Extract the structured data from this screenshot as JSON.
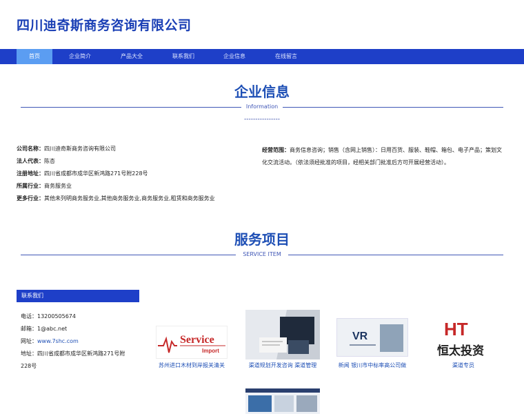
{
  "site": {
    "title": "四川迪奇斯商务咨询有限公司"
  },
  "nav": {
    "items": [
      {
        "label": "首页"
      },
      {
        "label": "企业简介"
      },
      {
        "label": "产品大全"
      },
      {
        "label": "联系我们"
      },
      {
        "label": "企业信息"
      },
      {
        "label": "在线留言"
      }
    ]
  },
  "company_info": {
    "title": "企业信息",
    "subtitle": "Information",
    "dashes": "----------------",
    "name_label": "公司名称：",
    "name": "四川迪奇斯商务咨询有限公司",
    "legal_label": "法人代表：",
    "legal": "陈杏",
    "address_label": "注册地址：",
    "address": "四川省成都市成华区新鸿路271号附228号",
    "industry_label": "所属行业：",
    "industry": "商务服务业",
    "more_label": "更多行业：",
    "more": "其他未列明商务服务业,其他商务服务业,商务服务业,租赁和商务服务业",
    "scope_label": "经营范围：",
    "scope": "商务信息咨询；销售（含网上销售）：日用百货、服装、鞋帽、箱包、电子产品；策划文化交流活动。（依法须经批准的项目，经相关部门批准后方可开展经营活动）。"
  },
  "services": {
    "title": "服务项目",
    "subtitle": "SERVICE ITEM"
  },
  "contact": {
    "header": "联系我们",
    "phone_label": "电话：",
    "phone": "13200505674",
    "email_label": "邮箱：",
    "email": "1@abc.net",
    "website_label": "网址：",
    "website": "www.7shc.com",
    "address_label": "地址：",
    "address_line1": "四川省成都市成华区新鸿路271号附",
    "address_line2": "228号"
  },
  "products": [
    {
      "caption": "苏州进口木材到岸报关清关",
      "logo_main": "Service",
      "logo_sub": "Import"
    },
    {
      "caption": "渠道规划开发咨询 渠道管理"
    },
    {
      "caption": "新闻 银川市中标率高公司做",
      "logo_text": "VR"
    },
    {
      "caption": "渠道专员",
      "logo_main": "HT",
      "logo_cn": "恒太投资"
    }
  ],
  "colors": {
    "brand": "#1e3fc8",
    "title_blue": "#1a3fb5",
    "nav_active": "#5b9df2"
  }
}
